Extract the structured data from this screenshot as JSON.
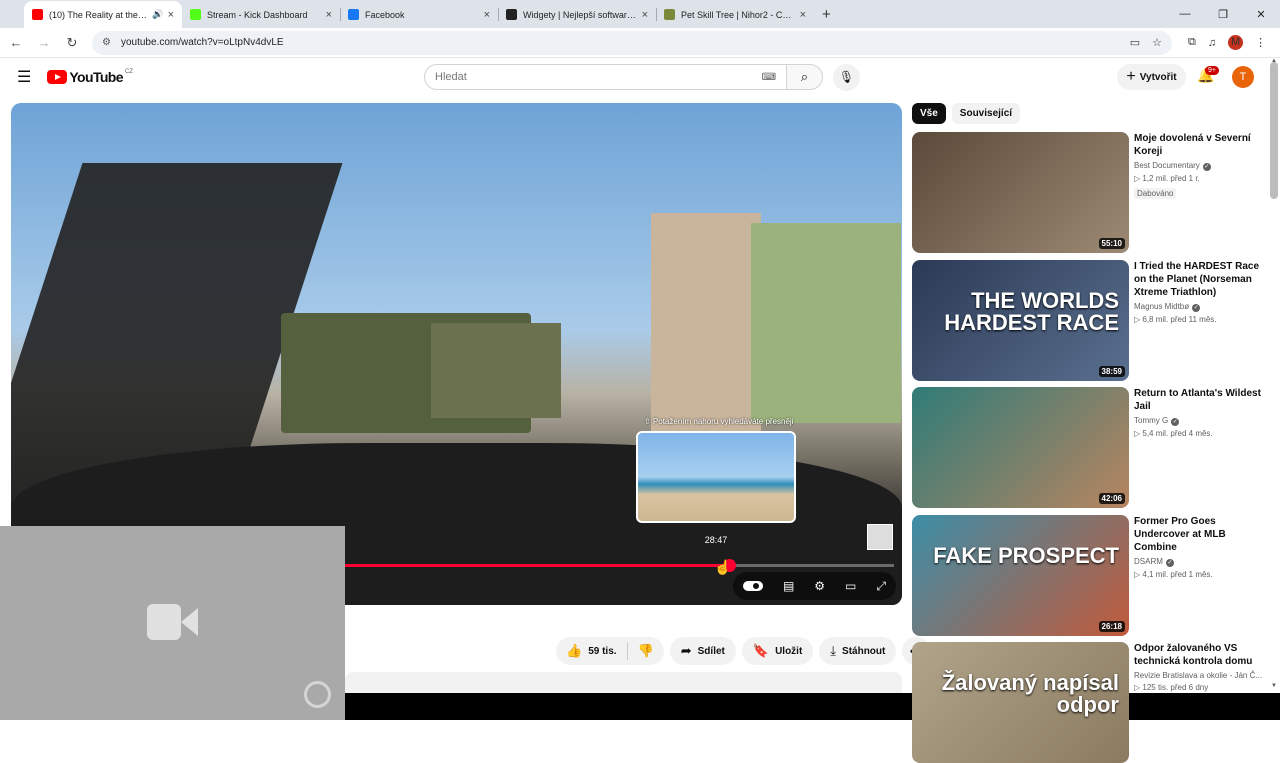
{
  "browser": {
    "tabs": [
      {
        "title": "(10) The Reality at the Ceuta",
        "favicon_color": "#ff0000",
        "active": true,
        "audio": true
      },
      {
        "title": "Stream - Kick Dashboard",
        "favicon_color": "#53fc18",
        "active": false
      },
      {
        "title": "Facebook",
        "favicon_color": "#1877f2",
        "active": false
      },
      {
        "title": "Widgety | Nejlepší software pro",
        "favicon_color": "#222222",
        "active": false
      },
      {
        "title": "Pet Skill Tree | Nihor2 - Chronic",
        "favicon_color": "#7a8a3a",
        "active": false
      }
    ],
    "new_tab": "+",
    "window_controls": {
      "minimize": "—",
      "restore": "❐",
      "close": "✕"
    },
    "url": "youtube.com/watch?v=oLtpNv4dvLE",
    "profile_letter": "M"
  },
  "header": {
    "logo_text": "YouTube",
    "country": "CZ",
    "search_placeholder": "Hledat",
    "create_label": "Vytvořit",
    "notifications": "9+",
    "avatar_letter": "T"
  },
  "player": {
    "drag_hint": "⇧ Potažením nahoru vyhledáváte přesněji",
    "hover_time": "28:47",
    "progress": 0.81
  },
  "actions": {
    "likes": "59 tis.",
    "share": "Sdílet",
    "save": "Uložit",
    "download": "Stáhnout"
  },
  "chips": [
    {
      "label": "Vše",
      "selected": true
    },
    {
      "label": "Související",
      "selected": false
    }
  ],
  "recommendations": [
    {
      "title": "Moje dovolená v Severní Koreji",
      "channel": "Best Documentary",
      "verified": true,
      "views": "1,2 mil.",
      "age": "před 1 r.",
      "tag": "Dabováno",
      "duration": "55:10",
      "thumb_text": "",
      "colors": [
        "#5b4a3a",
        "#9c8a74"
      ]
    },
    {
      "title": "I Tried the HARDEST Race on the Planet (Norseman Xtreme Triathlon)",
      "channel": "Magnus Midtbø",
      "verified": true,
      "views": "6,8 mil.",
      "age": "před 11 měs.",
      "tag": "",
      "duration": "38:59",
      "thumb_text": "THE WORLDS HARDEST RACE",
      "colors": [
        "#2b3a55",
        "#5a6f8f"
      ]
    },
    {
      "title": "Return to Atlanta's Wildest Jail",
      "channel": "Tommy G",
      "verified": true,
      "views": "5,4 mil.",
      "age": "před 4 měs.",
      "tag": "",
      "duration": "42:06",
      "thumb_text": "",
      "colors": [
        "#2f7c78",
        "#b88560"
      ]
    },
    {
      "title": "Former Pro Goes Undercover at MLB Combine",
      "channel": "DSARM",
      "verified": true,
      "views": "4,1 mil.",
      "age": "před 1 měs.",
      "tag": "",
      "duration": "26:18",
      "thumb_text": "FAKE PROSPECT",
      "colors": [
        "#3c8ea8",
        "#c25a3a"
      ]
    },
    {
      "title": "Odpor žalovaného VS technická kontrola domu",
      "channel": "Revizie Bratislava a okolie - Ján Č...",
      "verified": false,
      "views": "125 tis.",
      "age": "před 6 dny",
      "tag": "",
      "duration": "",
      "thumb_text": "Žalovaný napísal odpor",
      "colors": [
        "#b0a48a",
        "#8a7a60"
      ]
    }
  ]
}
